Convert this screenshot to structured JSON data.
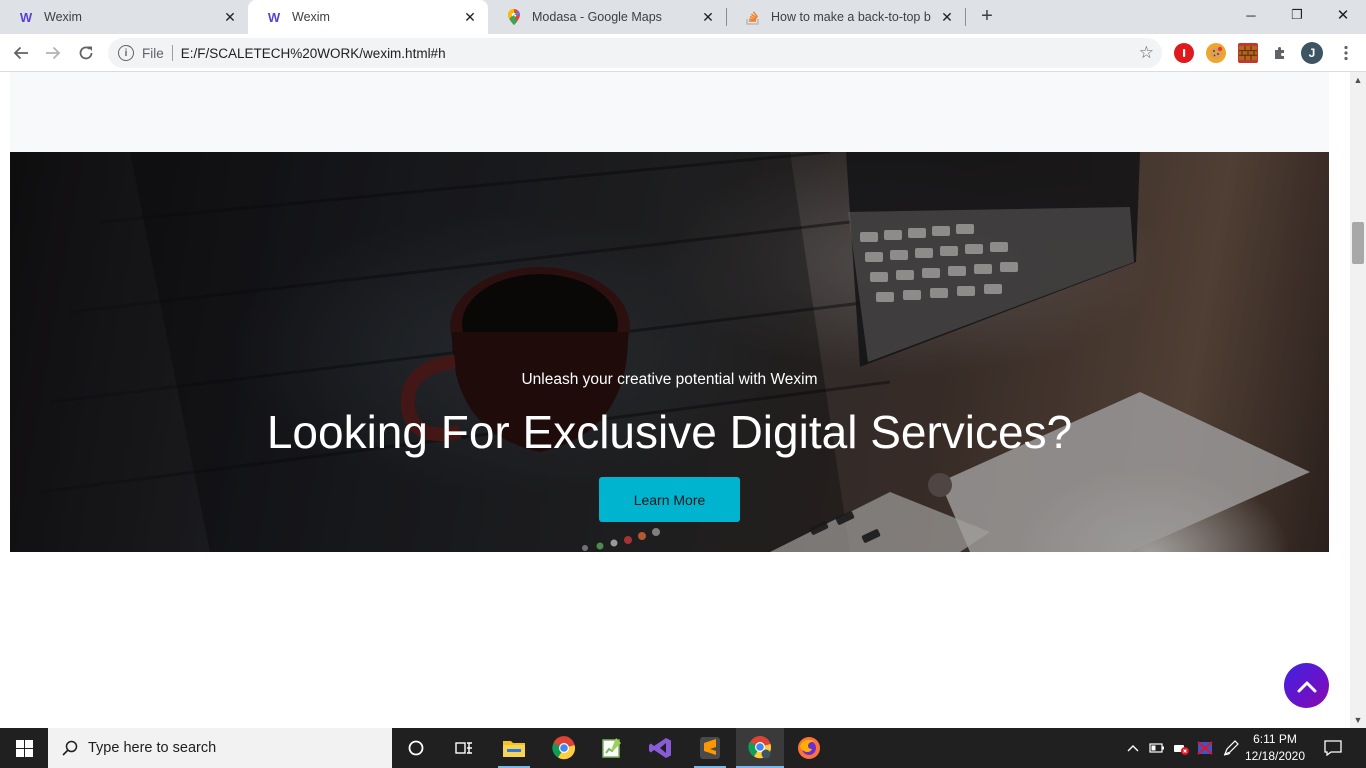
{
  "browser": {
    "tabs": [
      {
        "title": "Wexim",
        "favicon": "wexim-w-icon",
        "active": false
      },
      {
        "title": "Wexim",
        "favicon": "wexim-w-icon",
        "active": true
      },
      {
        "title": "Modasa - Google Maps",
        "favicon": "google-maps-pin-icon",
        "active": false
      },
      {
        "title": "How to make a back-to-top butt",
        "favicon": "stackoverflow-icon",
        "active": false
      }
    ],
    "window_controls": {
      "minimize": "─",
      "restore": "❐",
      "close": "✕"
    },
    "address": {
      "scheme_label": "File",
      "url": "E:/F/SCALETECH%20WORK/wexim.html#h"
    },
    "profile_initial": "J"
  },
  "page": {
    "hero": {
      "subtitle": "Unleash your creative potential with Wexim",
      "headline": "Looking For Exclusive Digital Services?",
      "cta_label": "Learn More"
    },
    "back_to_top": {
      "icon": "chevron-up-icon"
    }
  },
  "taskbar": {
    "search_placeholder": "Type here to search",
    "apps": [
      "cortana-circle-icon",
      "task-view-icon",
      "file-explorer-icon",
      "chrome-icon",
      "notepad-plus-icon",
      "visual-studio-icon",
      "sublime-text-icon",
      "chrome-profile-icon",
      "firefox-icon"
    ],
    "clock": {
      "time": "6:11 PM",
      "date": "12/18/2020"
    }
  },
  "colors": {
    "accent_cyan": "#00b4d0",
    "back_to_top_gradient": [
      "#3f24e0",
      "#8d0aa8"
    ],
    "wexim_brand": "#5b3fd6"
  }
}
